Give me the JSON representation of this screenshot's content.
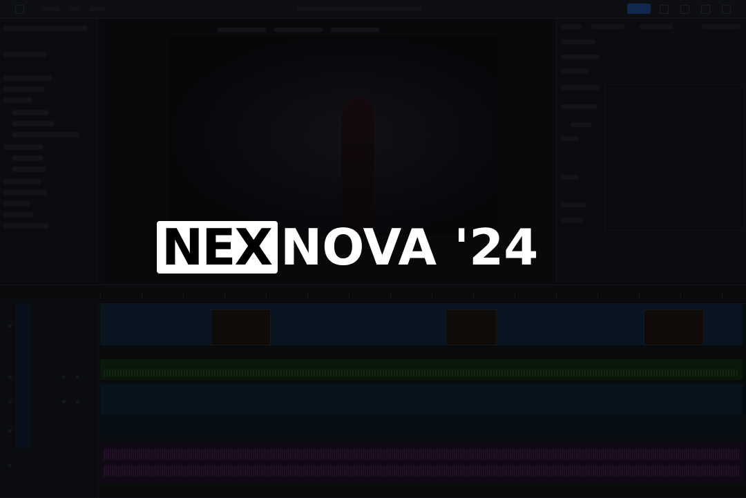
{
  "title": {
    "boxed": "NEX",
    "rest": "NOVA '24"
  },
  "colors": {
    "logo_text": "#ffffff",
    "logo_box_text": "#000000",
    "overlay": "rgba(0,0,0,0.35)",
    "video_track": "#0f1f33",
    "audio_green": "#10250f",
    "audio_blue": "#0c1d2b",
    "audio_purple": "#1c0f22",
    "export_button": "#1d3f7a"
  },
  "icons": [
    "home-icon",
    "export-icon",
    "settings-icon",
    "share-icon"
  ]
}
